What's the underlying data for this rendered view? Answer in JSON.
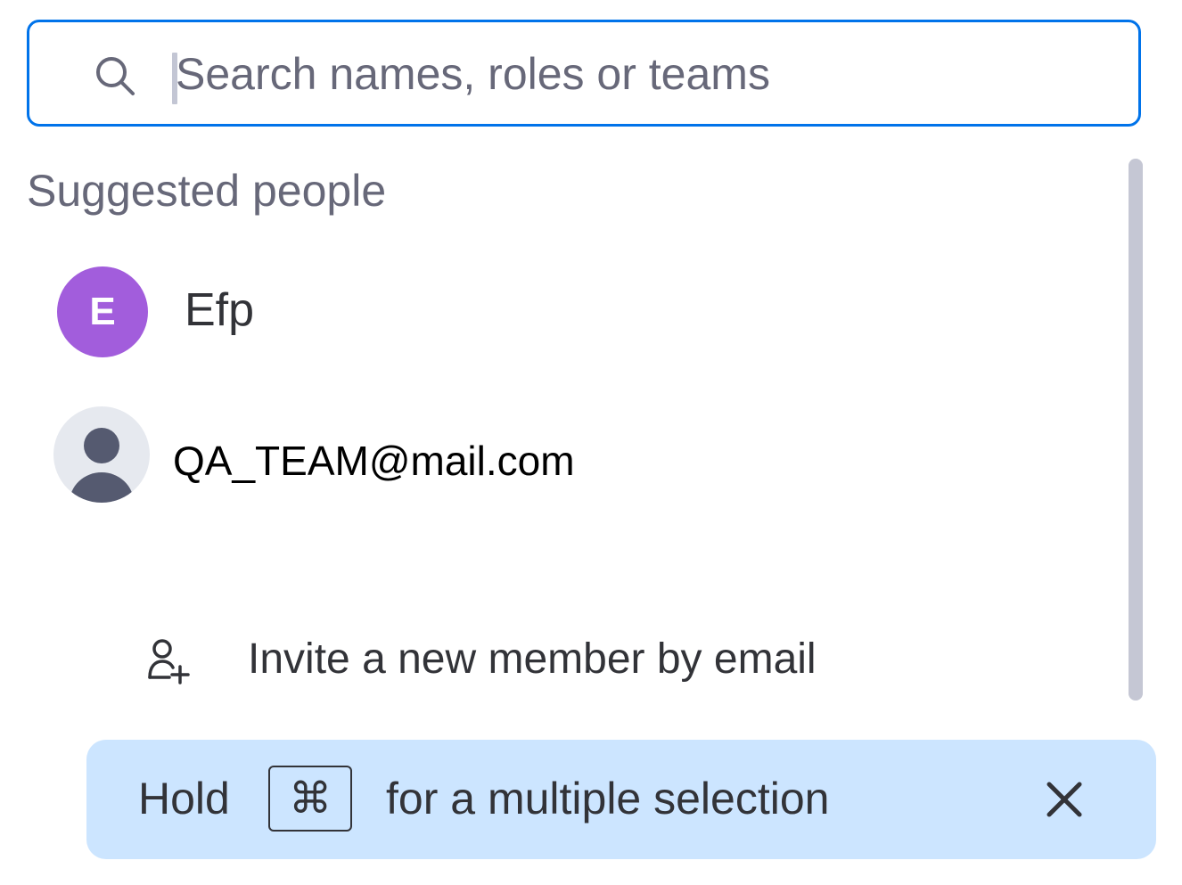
{
  "search": {
    "placeholder": "Search names, roles or teams",
    "value": "",
    "icon": "search-icon"
  },
  "suggested": {
    "title": "Suggested people",
    "people": [
      {
        "avatar_type": "letter",
        "avatar_letter": "E",
        "avatar_color": "#a25ddc",
        "name": "Efp"
      },
      {
        "avatar_type": "generic-person",
        "avatar_color": "#e6e9ef",
        "name": "QA_TEAM@mail.com"
      }
    ]
  },
  "invite": {
    "icon": "add-person-icon",
    "label": "Invite a new member by email"
  },
  "tip": {
    "hold": "Hold",
    "key": "⌘",
    "text": "for a multiple selection",
    "close_icon": "close-icon"
  },
  "colors": {
    "accent": "#0073ea",
    "tip_background": "#cce5ff",
    "text_primary": "#323338",
    "text_secondary": "#676879"
  }
}
